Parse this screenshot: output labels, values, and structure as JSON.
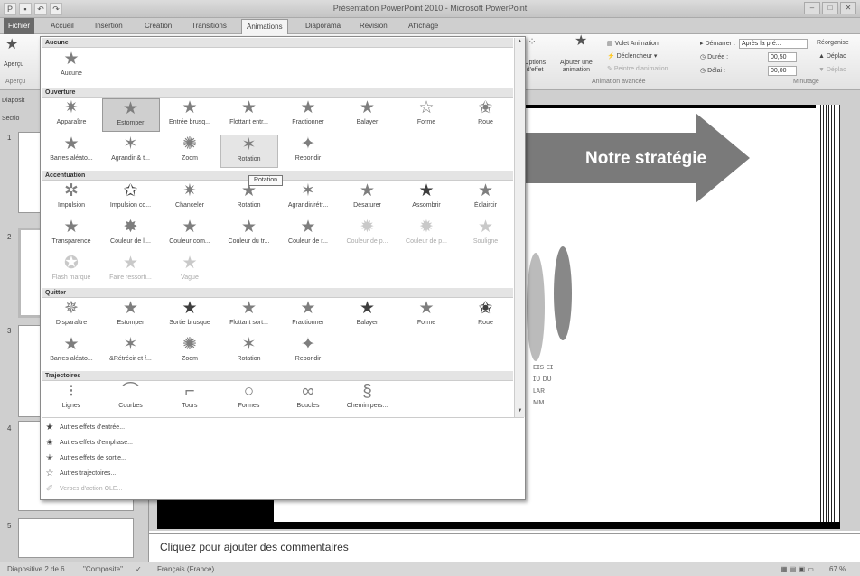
{
  "window": {
    "title": "Présentation PowerPoint 2010 - Microsoft PowerPoint"
  },
  "tabs": [
    "Fichier",
    "Accueil",
    "Insertion",
    "Création",
    "Transitions",
    "Animations",
    "Diaporama",
    "Révision",
    "Affichage"
  ],
  "ribbon": {
    "apercu": "Aperçu",
    "apercu_group": "Aperçu",
    "options": "Options\nd'effet",
    "ajouter": "Ajouter une\nanimation",
    "volet": "Volet Animation",
    "declencheur": "Déclencheur",
    "peintre": "Peintre d'animation",
    "anim_avancee": "Animation avancée",
    "demarrer_label": "Démarrer :",
    "demarrer_value": "Après la pré...",
    "duree_label": "Durée :",
    "duree_value": "00,50",
    "delai_label": "Délai :",
    "delai_value": "00,00",
    "minutage": "Minutage",
    "reorganiser": "Réorganise",
    "deplacer1": "Déplac",
    "deplacer2": "Déplac"
  },
  "sidebar": {
    "tab1": "Diaposit",
    "tab2": "Sectio",
    "slides": [
      "1",
      "2",
      "3",
      "4",
      "5"
    ]
  },
  "slide": {
    "arrow_text": "Notre stratégie"
  },
  "notes": "Cliquez pour ajouter des commentaires",
  "status": {
    "slide": "Diapositive 2 de 6",
    "theme": "\"Composite\"",
    "lang": "Français (France)",
    "zoom": "67 %"
  },
  "gallery": {
    "sections": {
      "aucune": "Aucune",
      "ouverture": "Ouverture",
      "accentuation": "Accentuation",
      "quitter": "Quitter",
      "trajectoires": "Trajectoires"
    },
    "aucune": [
      "Aucune"
    ],
    "ouverture": [
      "Apparaître",
      "Estomper",
      "Entrée brusq...",
      "Flottant entr...",
      "Fractionner",
      "Balayer",
      "Forme",
      "Roue",
      "Barres aléato...",
      "Agrandir & t...",
      "Zoom",
      "Rotation",
      "Rebondir"
    ],
    "accentuation": [
      "Impulsion",
      "Impulsion co...",
      "Chanceler",
      "Rotation",
      "Agrandir/rétr...",
      "Désaturer",
      "Assombrir",
      "Éclaircir",
      "Transparence",
      "Couleur de l'...",
      "Couleur com...",
      "Couleur du tr...",
      "Couleur de r...",
      "Couleur de p...",
      "Couleur de p...",
      "Souligne",
      "Flash marqué",
      "Faire ressorti...",
      "Vague"
    ],
    "quitter": [
      "Disparaître",
      "Estomper",
      "Sortie brusque",
      "Flottant sort...",
      "Fractionner",
      "Balayer",
      "Forme",
      "Roue",
      "Barres aléato...",
      "&Rétrécir et f...",
      "Zoom",
      "Rotation",
      "Rebondir"
    ],
    "trajectoires": [
      "Lignes",
      "Courbes",
      "Tours",
      "Formes",
      "Boucles",
      "Chemin pers..."
    ],
    "tooltip": "Rotation",
    "menu": [
      "Autres effets d'entrée...",
      "Autres effets d'emphase...",
      "Autres effets de sortie...",
      "Autres trajectoires...",
      "Verbes d'action OLE..."
    ]
  }
}
